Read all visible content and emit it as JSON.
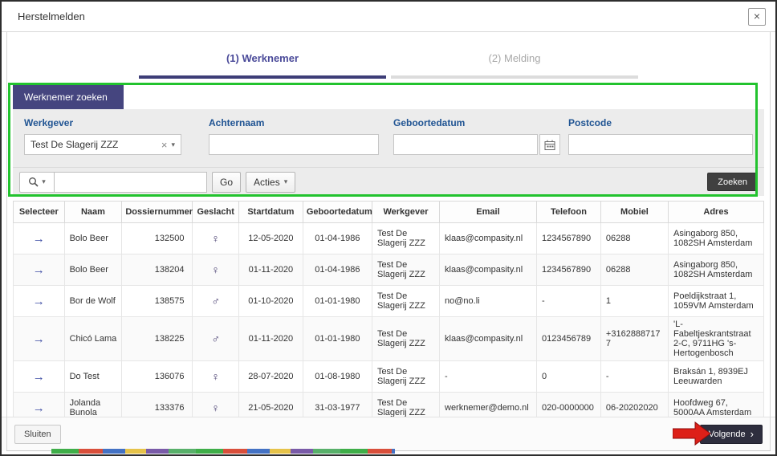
{
  "dialog": {
    "title": "Herstelmelden"
  },
  "icons": {
    "close": "×",
    "clear": "×",
    "dropdown": "▾"
  },
  "tabs": {
    "werknemer": "(1) Werknemer",
    "melding": "(2) Melding"
  },
  "search": {
    "panel_tab": "Werknemer zoeken",
    "werkgever_label": "Werkgever",
    "werkgever_value": "Test De Slagerij ZZZ",
    "achternaam_label": "Achternaam",
    "geboortedatum_label": "Geboortedatum",
    "postcode_label": "Postcode",
    "go_label": "Go",
    "acties_label": "Acties",
    "zoeken_label": "Zoeken"
  },
  "table": {
    "select_icon": "→",
    "headers": [
      "Selecteer",
      "Naam",
      "Dossiernummer",
      "Geslacht",
      "Startdatum",
      "Geboortedatum",
      "Werkgever",
      "Email",
      "Telefoon",
      "Mobiel",
      "Adres"
    ],
    "rows": [
      {
        "naam": "Bolo Beer",
        "dossiernummer": "132500",
        "geslacht": "♀",
        "startdatum": "12-05-2020",
        "geboortedatum": "01-04-1986",
        "werkgever": "Test De Slagerij ZZZ",
        "email": "klaas@compasity.nl",
        "telefoon": "1234567890",
        "mobiel": "06288",
        "adres": "Asingaborg 850, 1082SH Amsterdam"
      },
      {
        "naam": "Bolo Beer",
        "dossiernummer": "138204",
        "geslacht": "♀",
        "startdatum": "01-11-2020",
        "geboortedatum": "01-04-1986",
        "werkgever": "Test De Slagerij ZZZ",
        "email": "klaas@compasity.nl",
        "telefoon": "1234567890",
        "mobiel": "06288",
        "adres": "Asingaborg 850, 1082SH Amsterdam"
      },
      {
        "naam": "Bor de Wolf",
        "dossiernummer": "138575",
        "geslacht": "♂",
        "startdatum": "01-10-2020",
        "geboortedatum": "01-01-1980",
        "werkgever": "Test De Slagerij ZZZ",
        "email": "no@no.li",
        "telefoon": "-",
        "mobiel": "1",
        "adres": "Poeldijkstraat 1, 1059VM Amsterdam"
      },
      {
        "naam": "Chicó Lama",
        "dossiernummer": "138225",
        "geslacht": "♂",
        "startdatum": "01-11-2020",
        "geboortedatum": "01-01-1980",
        "werkgever": "Test De Slagerij ZZZ",
        "email": "klaas@compasity.nl",
        "telefoon": "0123456789",
        "mobiel": "+31628887177",
        "adres": "'L-Fabeltjeskrantstraat 2-C, 9711HG 's-Hertogenbosch"
      },
      {
        "naam": "Do Test",
        "dossiernummer": "136076",
        "geslacht": "♀",
        "startdatum": "28-07-2020",
        "geboortedatum": "01-08-1980",
        "werkgever": "Test De Slagerij ZZZ",
        "email": "-",
        "telefoon": "0",
        "mobiel": "-",
        "adres": "Braksán 1, 8939EJ Leeuwarden"
      },
      {
        "naam": "Jolanda Bunola",
        "dossiernummer": "133376",
        "geslacht": "♀",
        "startdatum": "21-05-2020",
        "geboortedatum": "31-03-1977",
        "werkgever": "Test De Slagerij ZZZ",
        "email": "werknemer@demo.nl",
        "telefoon": "020-0000000",
        "mobiel": "06-20202020",
        "adres": "Hoofdweg 67, 5000AA Amsterdam"
      }
    ]
  },
  "footer": {
    "sluiten": "Sluiten",
    "volgende": "Volgende",
    "volgende_chevron": "›"
  },
  "colors": {
    "accent_purple": "#45457f",
    "annotation_green": "#22c32e",
    "annotation_red": "#dd2018",
    "button_dark": "#404040"
  }
}
